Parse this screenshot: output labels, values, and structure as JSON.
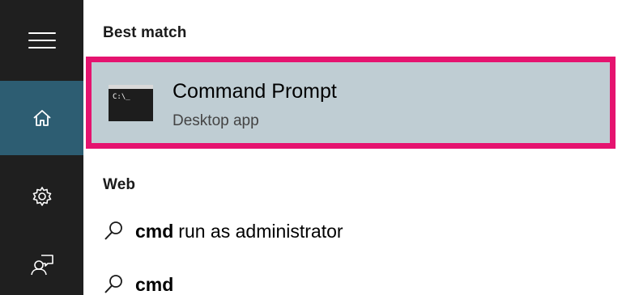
{
  "sidebar": {
    "items": [
      {
        "icon": "hamburger-menu-icon"
      },
      {
        "icon": "home-icon",
        "active": true
      },
      {
        "icon": "gear-icon"
      },
      {
        "icon": "feedback-icon"
      }
    ],
    "active_color": "#2d5d72",
    "background_color": "#1f1f1f"
  },
  "results": {
    "best_match_heading": "Best match",
    "best_match": {
      "title": "Command Prompt",
      "subtitle": "Desktop app",
      "icon_text": "C:\\_",
      "highlight_border_color": "#e5136f",
      "selected_background": "#bfcdd3"
    },
    "web_heading": "Web",
    "web_items": [
      {
        "bold": "cmd",
        "rest": "run as administrator"
      },
      {
        "bold": "cmd",
        "rest": ""
      }
    ]
  }
}
